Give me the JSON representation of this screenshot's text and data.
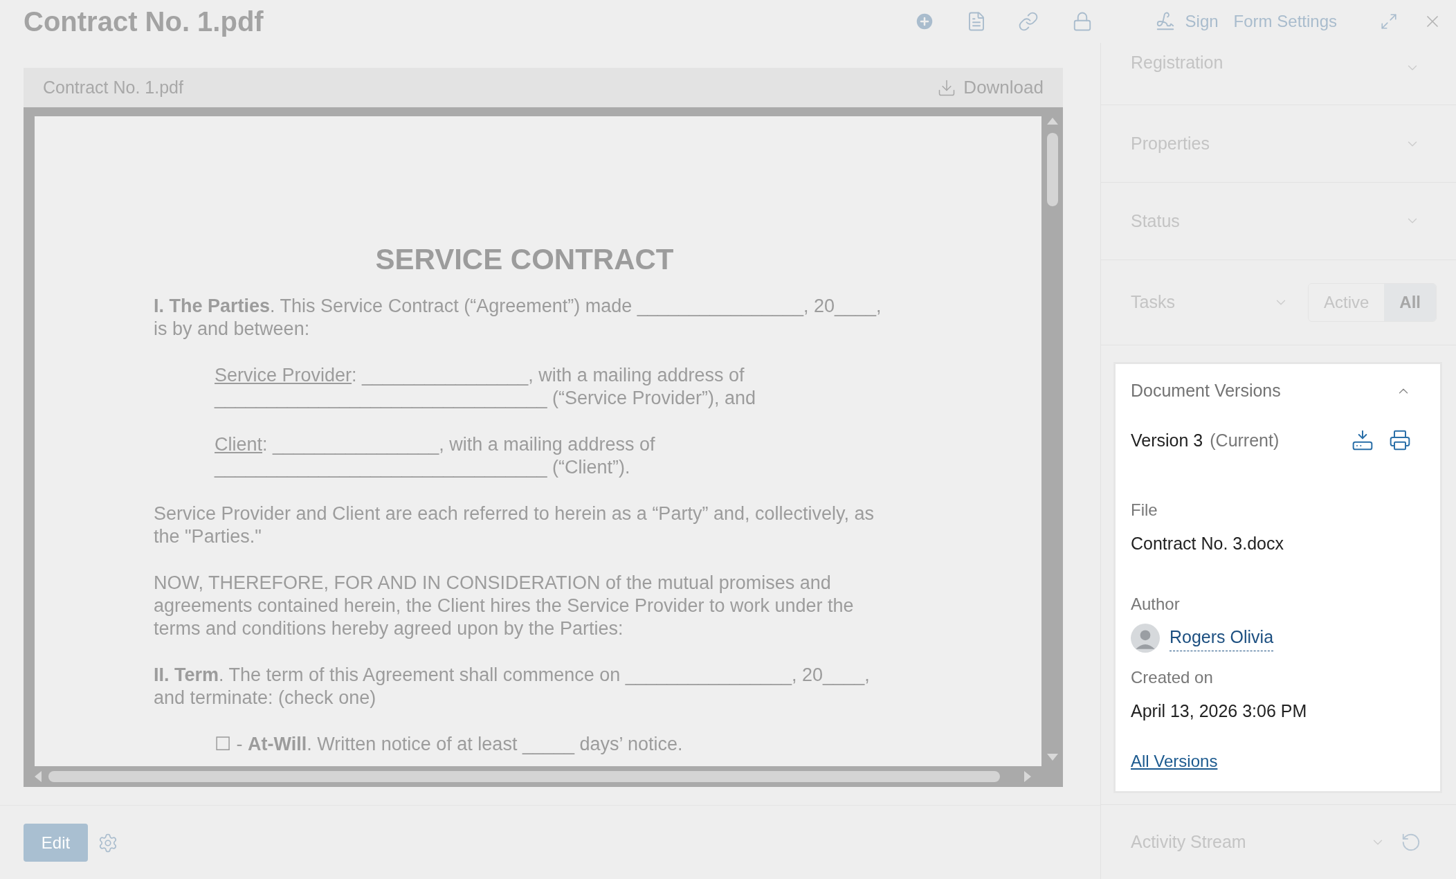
{
  "title": "Contract No. 1.pdf",
  "toolbar": {
    "sign": "Sign",
    "form_settings": "Form Settings"
  },
  "viewer": {
    "file_name": "Contract No. 1.pdf",
    "download": "Download",
    "document": {
      "title": "SERVICE CONTRACT",
      "blocks": [
        {
          "kind": "paragraph",
          "text": "**I. The Parties**. This Service Contract (“Agreement”) made ________________, 20____, is by and between:"
        },
        {
          "kind": "party",
          "label": "Service Provider",
          "lines": [
            ": ________________, with a mailing address of",
            "________________________________ (“Service Provider”), and"
          ]
        },
        {
          "kind": "party",
          "label": "Client",
          "lines": [
            ": ________________, with a mailing address of",
            "________________________________ (“Client”)."
          ]
        },
        {
          "kind": "paragraph",
          "text": "Service Provider and Client are each referred to herein as a “Party” and, collectively, as the \"Parties.\""
        },
        {
          "kind": "paragraph",
          "text": "NOW, THEREFORE, FOR AND IN CONSIDERATION of the mutual promises and agreements contained herein, the Client hires the Service Provider to work under the terms and conditions hereby agreed upon by the Parties:"
        },
        {
          "kind": "paragraph",
          "text": "**II. Term**. The term of this Agreement shall commence on ________________, 20____, and terminate: (check one)"
        },
        {
          "kind": "option",
          "text": "☐ - **At-Will**. Written notice of at least _____ days’ notice."
        }
      ]
    }
  },
  "edit_button": "Edit",
  "sidebar": {
    "sections": [
      {
        "label": "Registration",
        "expanded": false
      },
      {
        "label": "Properties",
        "expanded": false
      },
      {
        "label": "Status",
        "expanded": false
      }
    ],
    "tasks": {
      "label": "Tasks",
      "expanded": false,
      "filters": [
        {
          "label": "Active",
          "selected": false
        },
        {
          "label": "All",
          "selected": true
        }
      ]
    },
    "versions": {
      "label": "Document Versions",
      "expanded": true,
      "version": "Version 3",
      "current": "(Current)",
      "file_label": "File",
      "file": "Contract No. 3.docx",
      "author_label": "Author",
      "author": "Rogers Olivia",
      "created_label": "Created on",
      "created": "April 13, 2026 3:06 PM",
      "all_versions": "All Versions"
    },
    "activity": {
      "label": "Activity Stream",
      "expanded": false
    }
  }
}
